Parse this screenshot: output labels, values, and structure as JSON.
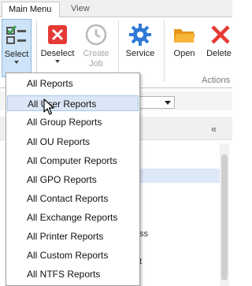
{
  "tabs": [
    {
      "label": "Main Menu",
      "active": true
    },
    {
      "label": "View",
      "active": false
    }
  ],
  "ribbon": {
    "buttons": {
      "select": {
        "label": "Select",
        "icon": "select-checklist-icon"
      },
      "deselect": {
        "label": "Deselect",
        "icon": "red-x-icon"
      },
      "create_job": {
        "label": "Create Job",
        "icon": "clock-icon",
        "enabled": false
      },
      "service": {
        "label": "Service",
        "icon": "gear-icon"
      },
      "open": {
        "label": "Open",
        "icon": "folder-icon"
      },
      "delete": {
        "label": "Delete",
        "icon": "red-x-icon"
      }
    },
    "groups": {
      "actions": "Actions"
    },
    "colors": {
      "accent_blue": "#2f7ad6",
      "danger_red": "#e53935",
      "folder_orange": "#f3a31b",
      "selected_bg": "#cde3f7"
    }
  },
  "menu": {
    "items": [
      "All Reports",
      "All User Reports",
      "All Group Reports",
      "All OU Reports",
      "All Computer Reports",
      "All GPO Reports",
      "All Contact Reports",
      "All Exchange Reports",
      "All Printer Reports",
      "All Custom Reports",
      "All NTFS Reports"
    ],
    "hovered_index": 1
  },
  "background": {
    "collapse_glyph": "«",
    "fragment_ss": "ss",
    "fragment_t": "t"
  }
}
